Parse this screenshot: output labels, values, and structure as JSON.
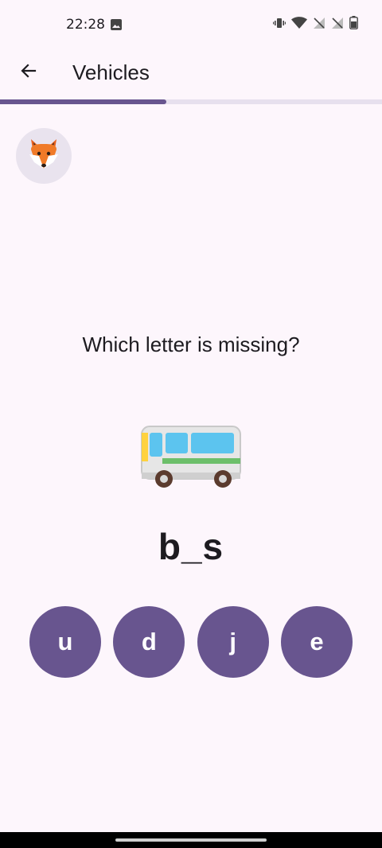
{
  "status_bar": {
    "time": "22:28",
    "icons": [
      "image-icon",
      "vibrate-icon",
      "wifi-icon",
      "no-signal-icon",
      "no-signal-icon",
      "battery-icon"
    ]
  },
  "app_bar": {
    "title": "Vehicles",
    "back_icon": "arrow-back-icon"
  },
  "progress": {
    "value": 0.435,
    "color": "#68558f",
    "track_color": "#e7e0ee"
  },
  "avatar": {
    "icon": "fox-icon"
  },
  "quiz": {
    "question": "Which letter is missing?",
    "picture_icon": "bus-icon",
    "word": "b_s",
    "options": [
      "u",
      "d",
      "j",
      "e"
    ]
  },
  "colors": {
    "background": "#fdf6fc",
    "accent": "#68558f",
    "text": "#1d1b20"
  }
}
